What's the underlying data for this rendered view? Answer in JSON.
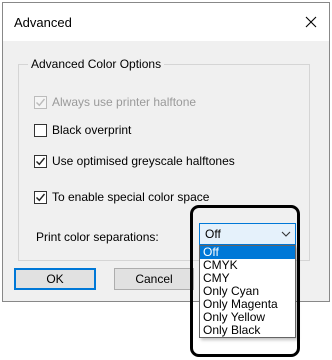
{
  "dialog": {
    "title": "Advanced",
    "close_icon": "close-icon",
    "group": {
      "title": "Advanced Color Options",
      "options": [
        {
          "label": "Always use printer halftone",
          "checked": true,
          "disabled": true
        },
        {
          "label": "Black overprint",
          "checked": false,
          "disabled": false
        },
        {
          "label": "Use optimised greyscale halftones",
          "checked": true,
          "disabled": false
        },
        {
          "label": "To enable special color space",
          "checked": true,
          "disabled": false
        }
      ],
      "separations": {
        "label": "Print color separations:",
        "selected": "Off",
        "options": [
          "Off",
          "CMYK",
          "CMY",
          "Only Cyan",
          "Only Magenta",
          "Only Yellow",
          "Only Black"
        ]
      }
    },
    "buttons": {
      "ok": "OK",
      "cancel": "Cancel"
    }
  },
  "colors": {
    "accent": "#0078d7",
    "dialog_bg": "#f0f0f0",
    "callout": "#000000"
  }
}
